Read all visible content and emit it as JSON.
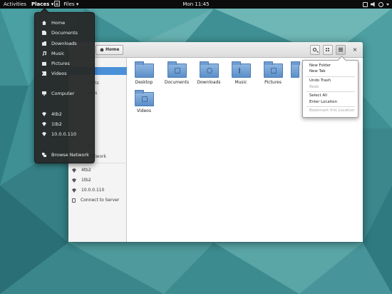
{
  "topbar": {
    "activities": "Activities",
    "places": "Places",
    "places_caret": "▾",
    "app_name": "Files",
    "app_caret": "▾",
    "clock": "Mon 11:45"
  },
  "places_menu": {
    "items": [
      {
        "label": "Home",
        "icon": "home-icon"
      },
      {
        "label": "Documents",
        "icon": "documents-icon"
      },
      {
        "label": "Downloads",
        "icon": "downloads-icon"
      },
      {
        "label": "Music",
        "icon": "music-icon"
      },
      {
        "label": "Pictures",
        "icon": "pictures-icon"
      },
      {
        "label": "Videos",
        "icon": "videos-icon"
      },
      {
        "label": "Computer",
        "icon": "computer-icon"
      },
      {
        "label": "4tb2",
        "icon": "drive-icon"
      },
      {
        "label": "1tb2",
        "icon": "drive-icon"
      },
      {
        "label": "10.0.0.110",
        "icon": "drive-icon"
      },
      {
        "label": "Browse Network",
        "icon": "network-icon"
      }
    ]
  },
  "window": {
    "path_button": "Home",
    "close_glyph": "×",
    "sidebar": {
      "partial_1": "nents",
      "partial_2": "oads",
      "partial_3": "ar",
      "partial_4": "Network",
      "items": [
        {
          "label": "4tb2"
        },
        {
          "label": "1tb2"
        },
        {
          "label": "10.0.0.110"
        },
        {
          "label": "Connect to Server"
        }
      ]
    },
    "folders": [
      {
        "label": "Desktop"
      },
      {
        "label": "Documents"
      },
      {
        "label": "Downloads"
      },
      {
        "label": "Music"
      },
      {
        "label": "Pictures"
      },
      {
        "label": ""
      },
      {
        "label": "Videos"
      }
    ]
  },
  "app_menu": {
    "items": [
      {
        "label": "New Folder",
        "enabled": true
      },
      {
        "label": "New Tab",
        "enabled": true
      },
      {
        "label": "Undo Trash",
        "enabled": true
      },
      {
        "label": "Redo",
        "enabled": false
      },
      {
        "label": "Select All",
        "enabled": true
      },
      {
        "label": "Enter Location",
        "enabled": true
      },
      {
        "label": "Bookmark this Location",
        "enabled": false
      }
    ]
  },
  "colors": {
    "desktop_teal": "#3d8f92",
    "topbar": "#0c0c0c",
    "selection_blue": "#4a90d9",
    "folder_blue": "#5b8fc9",
    "menu_dark": "#2c2e2e"
  }
}
